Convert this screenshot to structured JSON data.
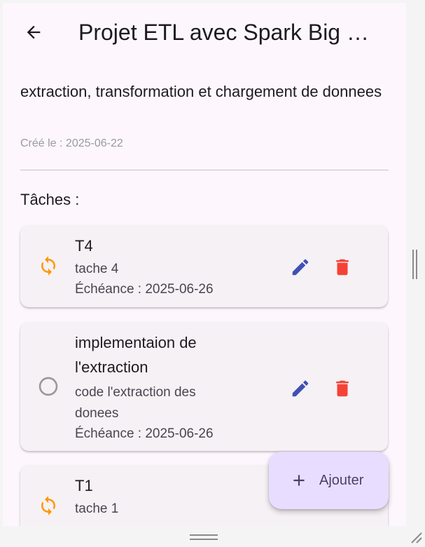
{
  "appbar": {
    "title": "Projet ETL avec Spark Big Data",
    "back_icon": "arrow-back-icon"
  },
  "project": {
    "description": "extraction, transformation et chargement de donneees",
    "description_display": "extraction, transformation et chargement de donnees",
    "created": "Créé le : 2025-06-22"
  },
  "tasks_label": "Tâches :",
  "tasks": [
    {
      "title": "T4",
      "description": "tache 4",
      "due": "Échéance : 2025-06-26",
      "status_icon": "sync-icon"
    },
    {
      "title": "implementaion de l'extraction",
      "description": "code l'extraction des donees",
      "due": "Échéance : 2025-06-26",
      "status_icon": "radio-unchecked-icon"
    },
    {
      "title": "T1",
      "description": "tache 1",
      "status_icon": "sync-icon"
    }
  ],
  "actions": {
    "edit_icon": "edit-icon",
    "delete_icon": "delete-icon"
  },
  "fab": {
    "label": "Ajouter",
    "icon": "plus-icon"
  },
  "colors": {
    "background": "#fdf7fd",
    "card": "#f6f1f5",
    "edit": "#3f51b5",
    "delete": "#f44336",
    "in_progress": "#ff9800",
    "fab_bg": "#e9ddff"
  }
}
